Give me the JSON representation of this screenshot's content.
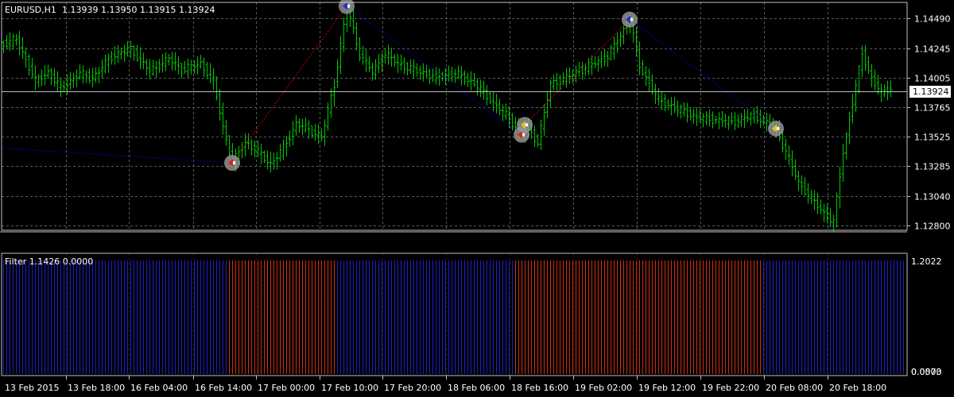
{
  "chart_data": [
    {
      "type": "candlestick",
      "symbol": "EURUSD,H1",
      "ohlc_readout": "1.13939 1.13950 1.13915 1.13924",
      "current_price": "1.13924",
      "y_ticks": [
        "1.14490",
        "1.14245",
        "1.14005",
        "1.13765",
        "1.13525",
        "1.13285",
        "1.13040",
        "1.12800"
      ],
      "ylim": [
        1.1276,
        1.1462
      ],
      "x_ticks": [
        "13 Feb 2015",
        "13 Feb 18:00",
        "16 Feb 04:00",
        "16 Feb 14:00",
        "17 Feb 00:00",
        "17 Feb 10:00",
        "17 Feb 20:00",
        "18 Feb 06:00",
        "18 Feb 16:00",
        "19 Feb 02:00",
        "19 Feb 12:00",
        "19 Feb 22:00",
        "20 Feb 08:00",
        "20 Feb 18:00"
      ],
      "bar_color": "#00c800",
      "zigzag": {
        "points": [
          {
            "bar": 72,
            "price": 1.1331
          },
          {
            "bar": 108,
            "price": 1.1459
          },
          {
            "bar": 163,
            "price": 1.1354
          },
          {
            "bar": 164,
            "price": 1.1362
          },
          {
            "bar": 197,
            "price": 1.1448
          },
          {
            "bar": 243,
            "price": 1.1359
          }
        ],
        "up_color": "#c80000",
        "down_color": "#0000c8",
        "pre_line": {
          "from_price": 1.1343,
          "to_price": 1.1331
        }
      }
    },
    {
      "type": "histogram",
      "label": "Filter 1.1426 0.0000",
      "y_ticks": [
        "1.2022",
        "0.0573",
        "0.0000"
      ],
      "segments": [
        {
          "color": "#2020c8",
          "count": 71
        },
        {
          "color": "#d03010",
          "count": 34
        },
        {
          "color": "#2020c8",
          "count": 56
        },
        {
          "color": "#d03010",
          "count": 78
        },
        {
          "color": "#2020c8",
          "count": 78
        },
        {
          "color": "#d03010",
          "count": 33
        }
      ]
    }
  ]
}
